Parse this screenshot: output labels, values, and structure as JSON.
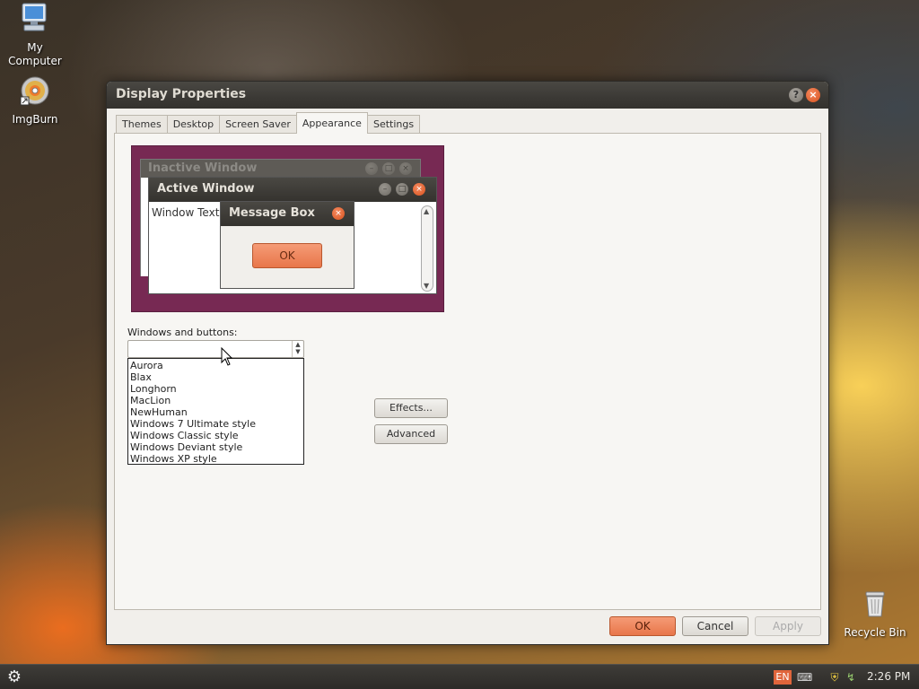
{
  "desktop": {
    "icons": [
      {
        "label": "My Computer",
        "icon": "computer-icon"
      },
      {
        "label": "ImgBurn",
        "icon": "disc-icon"
      },
      {
        "label": "Recycle Bin",
        "icon": "trash-icon"
      }
    ]
  },
  "window": {
    "title": "Display Properties",
    "help_icon": "?",
    "close_icon": "×",
    "tabs": [
      {
        "label": "Themes"
      },
      {
        "label": "Desktop"
      },
      {
        "label": "Screen Saver"
      },
      {
        "label": "Appearance",
        "active": true
      },
      {
        "label": "Settings"
      }
    ]
  },
  "preview": {
    "inactive_title": "Inactive Window",
    "active_title": "Active Window",
    "window_text": "Window Text",
    "message_title": "Message Box",
    "message_ok": "OK"
  },
  "appearance": {
    "windows_buttons_label": "Windows and buttons:",
    "selected_value": "",
    "options": [
      "Aurora",
      "Blax",
      "Longhorn",
      "MacLion",
      "NewHuman",
      "Windows 7 Ultimate style",
      "Windows Classic style",
      "Windows Deviant style",
      "Windows XP style"
    ],
    "effects_label": "Effects...",
    "advanced_label": "Advanced"
  },
  "buttons": {
    "ok": "OK",
    "cancel": "Cancel",
    "apply": "Apply"
  },
  "taskbar": {
    "language": "EN",
    "clock": "2:26 PM"
  },
  "colors": {
    "accent": "#e8764a",
    "titlebar": "#3b3935",
    "preview_bg": "#772953"
  }
}
